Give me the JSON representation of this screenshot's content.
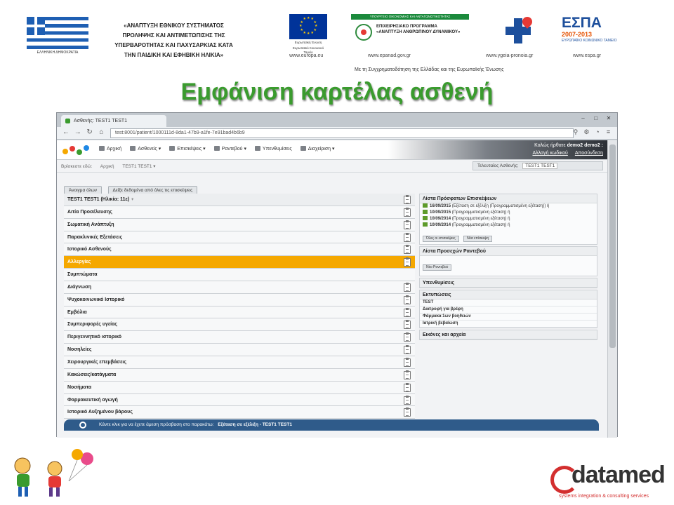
{
  "header": {
    "flag_caption": "ΕΛΛΗΝΙΚΗ ΔΗΜΟΚΡΑΤΙΑ",
    "ministry_lines": [
      "«ΑΝΑΠΤΥΞΗ ΕΘΝΙΚΟΥ ΣΥΣΤΗΜΑΤΟΣ",
      "ΠΡΟΛΗΨΗΣ ΚΑΙ ΑΝΤΙΜΕΤΩΠΙΣΗΣ ΤΗΣ",
      "ΥΠΕΡΒΑΡΟΤΗΤΑΣ ΚΑΙ ΠΑΧΥΣΑΡΚΙΑΣ ΚΑΤΑ",
      "ΤΗΝ ΠΑΙΔΙΚΗ ΚΑΙ ΕΦΗΒΙΚΗ ΗΛΙΚΙΑ»"
    ],
    "eu_caption": "Ευρωπαϊκή Ένωση",
    "eu_fund": "Ευρωπαϊκό Κοινωνικό Ταμείο",
    "op_bar": "ΥΠΟΥΡΓΕΙΟ ΟΙΚΟΝΟΜΙΑΣ ΚΑΙ ΑΝΤΑΓΩΝΙΣΤΙΚΟΤΗΤΑΣ",
    "op_title_1": "ΕΠΙΧΕΙΡΗΣΙΑΚΟ ΠΡΟΓΡΑΜΜΑ",
    "op_title_2": "«ΑΝΑΠΤΥΞΗ ΑΝΘΡΩΠΙΝΟΥ ΔΥΝΑΜΙΚΟΥ»",
    "espa_title": "ΕΣΠΑ",
    "espa_years": "2007-2013",
    "espa_sub": "ΕΥΡΩΠΑΪΚΟ ΚΟΙΝΩΝΙΚΟ ΤΑΜΕΙΟ",
    "url_eu": "www.europa.eu",
    "url_epanad": "www.epanad.gov.gr",
    "url_ygeia": "www.ygeia-pronoia.gr",
    "url_espa": "www.espa.gr",
    "cofund": "Με τη Συγχρηματοδότηση της Ελλάδας και της Ευρωπαϊκής Ένωσης"
  },
  "slide_title": "Εμφάνιση καρτέλας ασθενή",
  "browser": {
    "tab_title": "Ασθενής: TEST1 TEST1",
    "url": "test:8001/patient/1000111d-8da1-47b9-a1fe-7e91bad4b6b9"
  },
  "app": {
    "menu": [
      "Αρχική",
      "Ασθενείς ▾",
      "Επισκέψεις ▾",
      "Ραντεβού ▾",
      "Υπενθυμίσεις",
      "Διαχείριση ▾"
    ],
    "welcome_prefix": "Καλώς ήρθατε",
    "user_name": "demo2 demo2 :",
    "change_password": "Αλλαγή κωδικού",
    "logout": "Αποσύνδεση",
    "breadcrumbs": [
      "Βρίσκεστε εδώ:",
      "Αρχική",
      "TEST1 TEST1 ▾"
    ],
    "last_patient_label": "Τελευταίος Ασθενής:",
    "last_patient_name": "TEST1 TEST1"
  },
  "buttons": {
    "open_all": "Άνοιγμα όλων",
    "show_all_data": "Δείξε δεδομένα από όλες τις επισκέψεις"
  },
  "sections": [
    {
      "label": "TEST1 TEST1 (Ηλικία: 11ε) ♀",
      "type": "head"
    },
    {
      "label": "Αιτία Προσέλευσης",
      "type": "normal"
    },
    {
      "label": "Σωματική Ανάπτυξη",
      "type": "normal"
    },
    {
      "label": "Παρακλινικές Εξετάσεις",
      "type": "normal"
    },
    {
      "label": "Ιστορικό Ασθενούς",
      "type": "normal"
    },
    {
      "label": "Αλλεργίες",
      "type": "active"
    },
    {
      "label": "Συμπτώματα",
      "type": "noicon"
    },
    {
      "label": "Διάγνωση",
      "type": "normal"
    },
    {
      "label": "Ψυχοκοινωνικό Ιστορικό",
      "type": "normal"
    },
    {
      "label": "Εμβόλια",
      "type": "normal"
    },
    {
      "label": "Συμπεριφορές υγείας",
      "type": "normal"
    },
    {
      "label": "Περιγεννητικό ιστορικό",
      "type": "normal"
    },
    {
      "label": "Νοσηλείες",
      "type": "normal"
    },
    {
      "label": "Χειρουργικές επεμβάσεις",
      "type": "normal"
    },
    {
      "label": "Κακώσεις/κατάγματα",
      "type": "normal"
    },
    {
      "label": "Νοσήματα",
      "type": "normal"
    },
    {
      "label": "Φαρμακευτική αγωγή",
      "type": "normal"
    },
    {
      "label": "Ιστορικό Αυξημένου βάρους",
      "type": "normal"
    }
  ],
  "right_panel": {
    "recent_visits_title": "Λίστα Πρόσφατων Επισκέψεων",
    "visits": [
      {
        "date": "16/09/2015",
        "desc": "(Εξέταση σε εξέλιξη (Προγραμματισμένη εξέταση)) ή"
      },
      {
        "date": "10/09/2015",
        "desc": "(Προγραμματισμένη εξέταση) ή"
      },
      {
        "date": "10/09/2014",
        "desc": "(Προγραμματισμένη εξέταση) ή"
      },
      {
        "date": "10/09/2014",
        "desc": "(Προγραμματισμένη εξέταση) ή"
      }
    ],
    "all_visits_btn": "Όλες οι επισκέψεις",
    "new_visit_btn": "Νέα επίσκεψη",
    "appointments_title": "Λίστα Προσεχών Ραντεβού",
    "new_appointment_btn": "Νέο Ραντεβού",
    "reminders_title": "Υπενθυμίσεις",
    "prints_title": "Εκτυπώσεις",
    "prints": [
      "TEST",
      "Διατροφή για βρέφη",
      "Φάρμακα 1ων βοηθειών",
      "Ιατρική βεβαίωση"
    ],
    "images_title": "Εικόνες και αρχεία"
  },
  "footer": {
    "prompt": "Κάντε κλικ για να έχετε άμεση πρόσβαση στο παρακάτω:",
    "link": "Εξέταση σε εξέλιξη - TEST1 TEST1"
  },
  "branding": {
    "datamed": "datamed",
    "datamed_sub": "systems integration & consulting services"
  }
}
